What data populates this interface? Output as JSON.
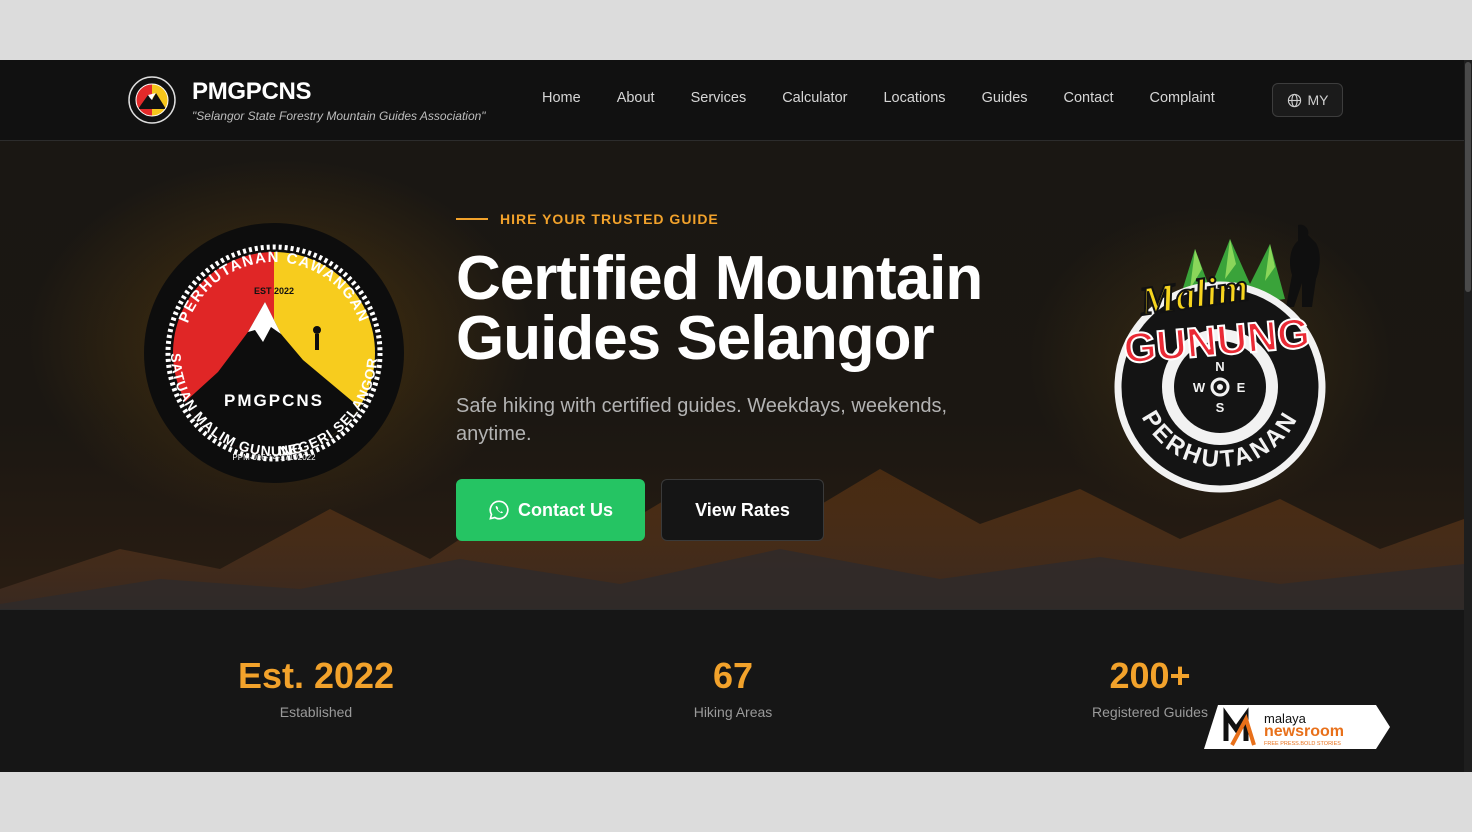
{
  "nav": {
    "brand_name": "PMGPCNS",
    "brand_tagline": "\"Selangor State Forestry Mountain Guides Association\"",
    "items": [
      {
        "label": "Home"
      },
      {
        "label": "About"
      },
      {
        "label": "Services"
      },
      {
        "label": "Calculator"
      },
      {
        "label": "Locations"
      },
      {
        "label": "Guides"
      },
      {
        "label": "Contact"
      },
      {
        "label": "Complaint"
      }
    ],
    "language": "MY",
    "language_icon": "globe-icon"
  },
  "hero": {
    "eyebrow": "HIRE YOUR TRUSTED GUIDE",
    "headline_line1": "Certified Mountain",
    "headline_line2": "Guides Selangor",
    "subtitle": "Safe hiking with certified guides. Weekdays, weekends, anytime.",
    "contact_button": "Contact Us",
    "contact_icon": "whatsapp-icon",
    "rates_button": "View Rates",
    "left_emblem": {
      "top_text": "PERHUTANAN CAWANGAN",
      "side_left": "PERSATUAN MALIM GUNUNG",
      "side_right": "NEGERI SELANGOR",
      "est": "EST 2022",
      "center": "PMGPCNS",
      "reg": "PPM-016-14-17102022"
    },
    "right_emblem": {
      "line1": "Malim",
      "line2": "GUNUNG",
      "bottom": "PERHUTANAN",
      "compass_n": "N",
      "compass_s": "S",
      "compass_w": "W",
      "compass_e": "E"
    }
  },
  "stats": [
    {
      "value": "Est. 2022",
      "label": "Established"
    },
    {
      "value": "67",
      "label": "Hiking Areas"
    },
    {
      "value": "200+",
      "label": "Registered Guides"
    }
  ],
  "watermark": {
    "top": "malaya",
    "mid": "newsroom",
    "tag": "FREE PRESS.BOLD STORIES"
  },
  "colors": {
    "accent": "#f2a22b",
    "whatsapp": "#25c463",
    "background": "#161616"
  }
}
